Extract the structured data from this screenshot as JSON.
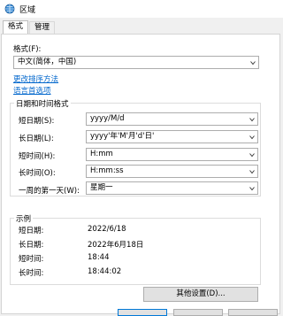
{
  "window": {
    "title": "区域"
  },
  "tabs": [
    {
      "label": "格式",
      "active": true
    },
    {
      "label": "管理",
      "active": false
    }
  ],
  "format": {
    "label": "格式(F):",
    "value": "中文(简体，中国)"
  },
  "links": {
    "sort": "更改排序方法",
    "language": "语言首选项"
  },
  "datetime_group": {
    "title": "日期和时间格式",
    "rows": [
      {
        "label": "短日期(S):",
        "value": "yyyy/M/d"
      },
      {
        "label": "长日期(L):",
        "value": "yyyy'年'M'月'd'日'"
      },
      {
        "label": "短时间(H):",
        "value": "H:mm"
      },
      {
        "label": "长时间(O):",
        "value": "H:mm:ss"
      },
      {
        "label": "一周的第一天(W):",
        "value": "星期一"
      }
    ]
  },
  "example_group": {
    "title": "示例",
    "rows": [
      {
        "label": "短日期:",
        "value": "2022/6/18"
      },
      {
        "label": "长日期:",
        "value": "2022年6月18日"
      },
      {
        "label": "短时间:",
        "value": "18:44"
      },
      {
        "label": "长时间:",
        "value": "18:44:02"
      }
    ]
  },
  "buttons": {
    "other_settings": "其他设置(D)..."
  },
  "colors": {
    "link": "#0066cc",
    "accent": "#0078d7"
  }
}
